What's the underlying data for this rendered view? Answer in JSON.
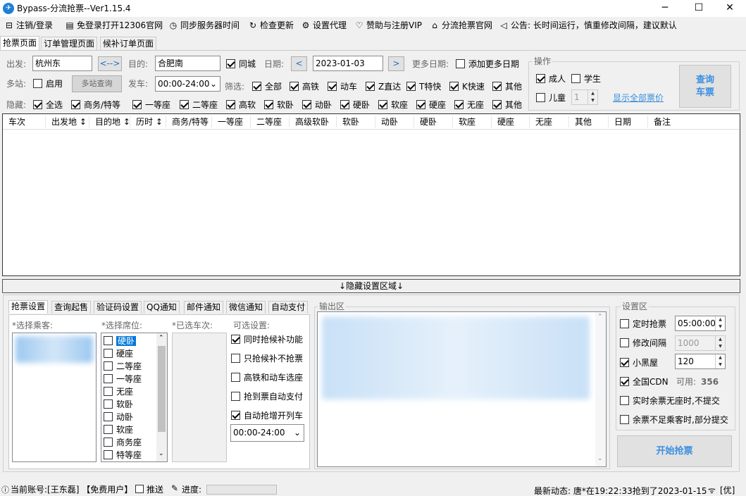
{
  "window": {
    "title": "Bypass-分流抢票--Ver1.15.4",
    "minimize": "─",
    "maximize": "☐",
    "close": "✕",
    "icon_text": "✈"
  },
  "menu": [
    {
      "icon": "⊟",
      "label": "注销/登录"
    },
    {
      "icon": "▤",
      "label": "免登录打开12306官网"
    },
    {
      "icon": "◷",
      "label": "同步服务器时间"
    },
    {
      "icon": "↻",
      "label": "检查更新"
    },
    {
      "icon": "⚙",
      "label": "设置代理"
    },
    {
      "icon": "♡",
      "label": "赞助与注册VIP"
    },
    {
      "icon": "⌂",
      "label": "分流抢票官网"
    },
    {
      "icon": "◁",
      "label": "公告: 长时间运行，慎重修改间隔，建议默认"
    }
  ],
  "tabs": [
    "抢票页面",
    "订单管理页面",
    "候补订单页面"
  ],
  "query": {
    "from_label": "出发:",
    "from_value": "杭州东",
    "swap_label": "<-->",
    "to_label": "目的:",
    "to_value": "合肥南",
    "same_city": "同城",
    "date_label": "日期:",
    "date_prev": "<",
    "date_value": "2023-01-03",
    "date_next": ">",
    "more_dates_label": "更多日期:",
    "add_more_dates": "添加更多日期",
    "multi_label": "多站:",
    "multi_enable": "启用",
    "multi_query": "多站查询",
    "depart_label": "发车:",
    "depart_value": "00:00-24:00",
    "filter_label": "筛选:",
    "filters": [
      "全部",
      "高铁",
      "动车",
      "Z直达",
      "T特快",
      "K快速",
      "其他"
    ],
    "hide_label": "隐藏:",
    "hide_items": [
      "全选",
      "商务/特等",
      "一等座",
      "二等座",
      "高软",
      "软卧",
      "动卧",
      "硬卧",
      "软座",
      "硬座",
      "无座",
      "其他"
    ]
  },
  "operation": {
    "title": "操作",
    "adult": "成人",
    "student": "学生",
    "child": "儿童",
    "child_count": "1",
    "show_all_prices": "显示全部票价",
    "query_button_line1": "查询",
    "query_button_line2": "车票"
  },
  "grid_columns": [
    "车次",
    "出发地 ↕",
    "目的地 ↕",
    "历时 ↕",
    "商务/特等",
    "一等座",
    "二等座",
    "高级软卧",
    "软卧",
    "动卧",
    "硬卧",
    "软座",
    "硬座",
    "无座",
    "其他",
    "日期",
    "备注"
  ],
  "hide_settings_bar": "↓隐藏设置区域↓",
  "bottom_tabs": [
    "抢票设置",
    "查询起售",
    "验证码设置",
    "QQ通知",
    "邮件通知",
    "微信通知",
    "自动支付"
  ],
  "booking": {
    "passenger_label": "*选择乘客:",
    "seat_label": "*选择席位:",
    "seats": [
      "硬卧",
      "硬座",
      "二等座",
      "一等座",
      "无座",
      "软卧",
      "动卧",
      "软座",
      "商务座",
      "特等座"
    ],
    "selected_train_label": "*已选车次:",
    "optional_label": "可选设置:",
    "options": [
      {
        "label": "同时抢候补功能",
        "checked": true
      },
      {
        "label": "只抢候补不抢票",
        "checked": false
      },
      {
        "label": "高铁和动车选座",
        "checked": false
      },
      {
        "label": "抢到票自动支付",
        "checked": false
      },
      {
        "label": "自动抢增开列车",
        "checked": true
      }
    ],
    "time_range": "00:00-24:00"
  },
  "output": {
    "title": "输出区"
  },
  "settings": {
    "title": "设置区",
    "timed_grab": "定时抢票",
    "timed_value": "05:00:00",
    "modify_interval": "修改间隔",
    "interval_value": "1000",
    "blackroom": "小黑屋",
    "blackroom_value": "120",
    "cdn": "全国CDN",
    "cdn_available_label": "可用:",
    "cdn_available": "356",
    "realtime_no_submit": "实时余票无座时,不提交",
    "partial_submit": "余票不足乘客时,部分提交",
    "start_button": "开始抢票"
  },
  "status": {
    "account": "当前账号:[王东磊] 【免费用户】",
    "push": "推送",
    "progress_label": "进度:",
    "news": "最新动态: 唐*在19:22:33抢到了2023-01-15",
    "tail": "[优]"
  }
}
